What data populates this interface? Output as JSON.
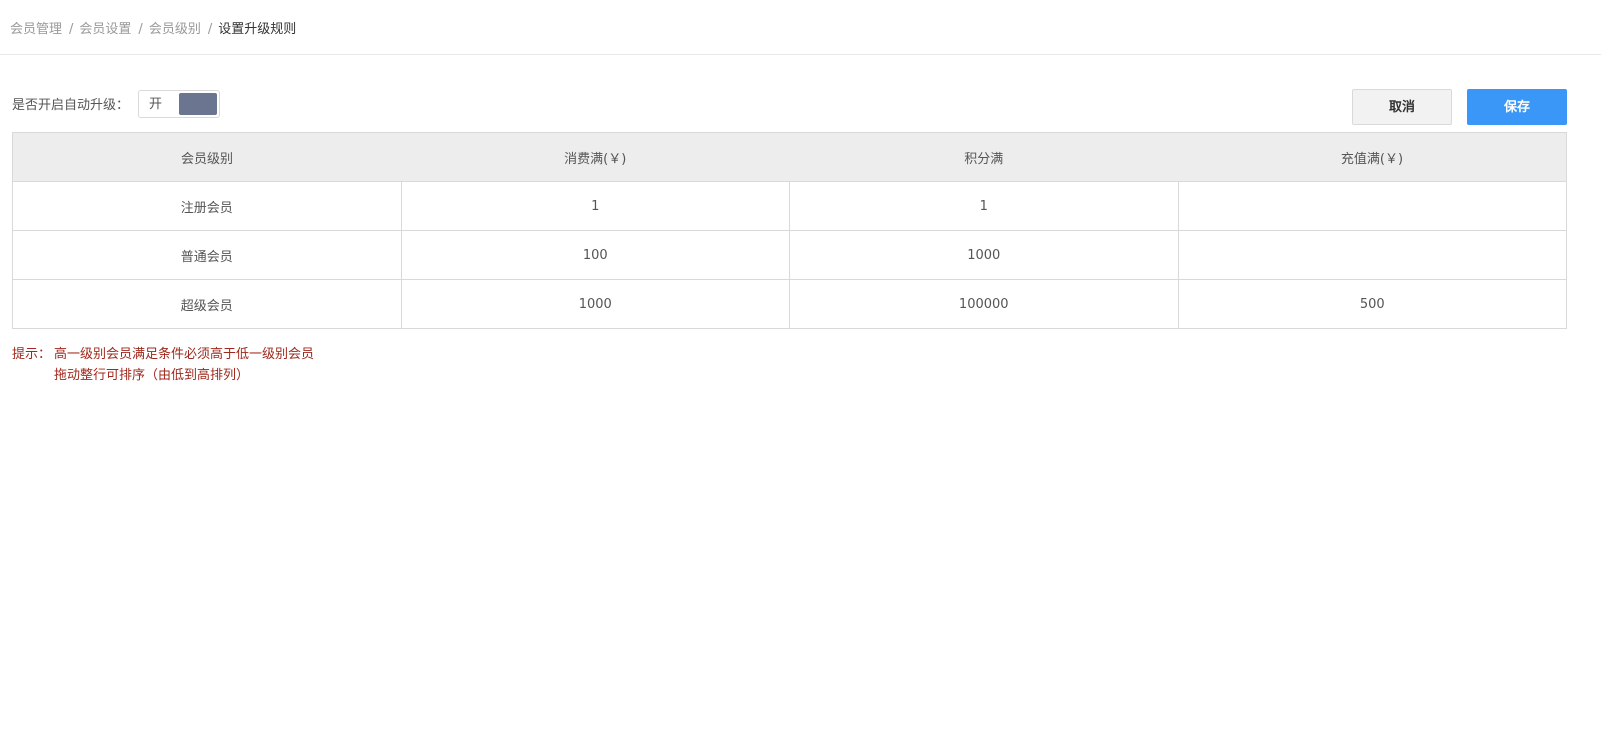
{
  "breadcrumb": {
    "items": [
      "会员管理",
      "会员设置",
      "会员级别"
    ],
    "current": "设置升级规则",
    "separator": "/"
  },
  "auto_upgrade": {
    "label": "是否开启自动升级：",
    "switch_text": "开",
    "enabled": true
  },
  "buttons": {
    "cancel": "取消",
    "save": "保存"
  },
  "table": {
    "headers": [
      "会员级别",
      "消费满(￥)",
      "积分满",
      "充值满(￥)"
    ],
    "rows": [
      [
        "注册会员",
        "1",
        "1",
        ""
      ],
      [
        "普通会员",
        "100",
        "1000",
        ""
      ],
      [
        "超级会员",
        "1000",
        "100000",
        "500"
      ]
    ]
  },
  "tips": {
    "prefix": "提示：",
    "lines": [
      "高一级别会员满足条件必须高于低一级别会员",
      "拖动整行可排序（由低到高排列）"
    ]
  },
  "colors": {
    "primary": "#3a97f7",
    "switch_knob": "#6b7590",
    "tip_text": "#a0281c"
  }
}
